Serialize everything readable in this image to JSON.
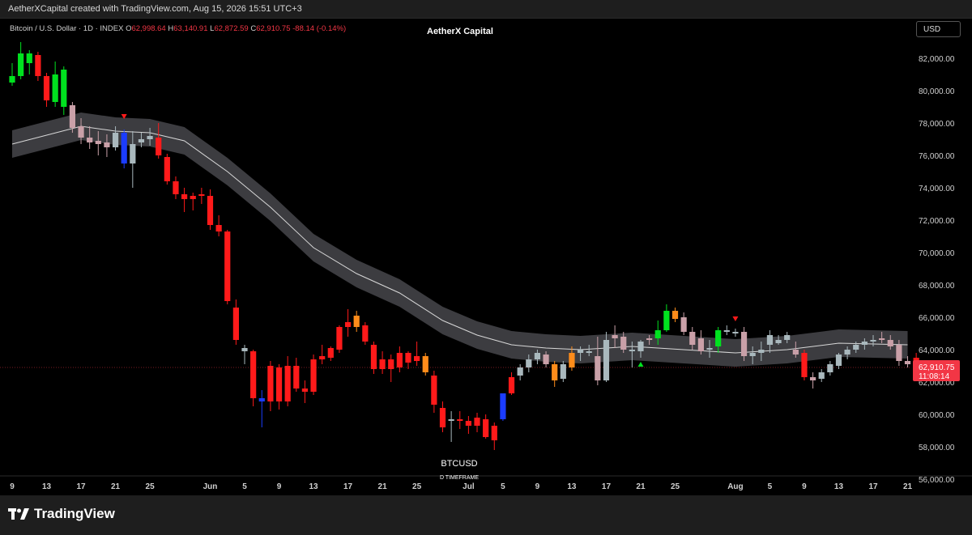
{
  "header": {
    "attribution": "AetherXCapital created with TradingView.com, Aug 15, 2026 15:51 UTC+3"
  },
  "legend": {
    "symbol": "Bitcoin / U.S. Dollar · 1D · INDEX",
    "o_label": "O",
    "o_value": "62,998.64",
    "h_label": "H",
    "h_value": "63,140.91",
    "l_label": "L",
    "l_value": "62,872.59",
    "c_label": "C",
    "c_value": "62,910.75",
    "change": "-88.14 (-0.14%)"
  },
  "chart_title": "AetherX Capital",
  "currency": "USD",
  "brand": "TradingView",
  "chart_data": {
    "type": "candlestick",
    "title": "AetherX Capital",
    "symbol": "BTCUSD",
    "timeframe_label": "D TIMEFRAME",
    "ylim": [
      55000,
      84500
    ],
    "y_ticks": [
      56000,
      58000,
      60000,
      62000,
      64000,
      66000,
      68000,
      70000,
      72000,
      74000,
      76000,
      78000,
      80000,
      82000
    ],
    "y_tick_labels": [
      "56,000.00",
      "58,000.00",
      "60,000.00",
      "62,000.00",
      "64,000.00",
      "66,000.00",
      "68,000.00",
      "70,000.00",
      "72,000.00",
      "74,000.00",
      "76,000.00",
      "78,000.00",
      "80,000.00",
      "82,000.00"
    ],
    "x_ticks": [
      {
        "i": 0,
        "label": "9"
      },
      {
        "i": 4,
        "label": "13"
      },
      {
        "i": 8,
        "label": "17"
      },
      {
        "i": 12,
        "label": "21"
      },
      {
        "i": 16,
        "label": "25"
      },
      {
        "i": 23,
        "label": "Jun"
      },
      {
        "i": 27,
        "label": "5"
      },
      {
        "i": 31,
        "label": "9"
      },
      {
        "i": 35,
        "label": "13"
      },
      {
        "i": 39,
        "label": "17"
      },
      {
        "i": 43,
        "label": "21"
      },
      {
        "i": 47,
        "label": "25"
      },
      {
        "i": 53,
        "label": "Jul"
      },
      {
        "i": 57,
        "label": "5"
      },
      {
        "i": 61,
        "label": "9"
      },
      {
        "i": 65,
        "label": "13"
      },
      {
        "i": 69,
        "label": "17"
      },
      {
        "i": 73,
        "label": "21"
      },
      {
        "i": 77,
        "label": "25"
      },
      {
        "i": 84,
        "label": "Aug"
      },
      {
        "i": 88,
        "label": "5"
      },
      {
        "i": 92,
        "label": "9"
      },
      {
        "i": 96,
        "label": "13"
      },
      {
        "i": 100,
        "label": "17"
      },
      {
        "i": 104,
        "label": "21"
      }
    ],
    "last_price": "62,910.75",
    "countdown": "11:08:14",
    "colors": {
      "bull": "#00e21f",
      "bear": "#ff1a1a",
      "neutral": "#a9b8bd",
      "pink": "#c9a0a8",
      "orange": "#ff8c1a",
      "blue": "#1b3cff",
      "band": "#46464b",
      "ma": "#d8d8d8",
      "price_line": "#f23645"
    },
    "candles": [
      {
        "o": 80500,
        "h": 81700,
        "l": 80300,
        "c": 80900,
        "k": "bull"
      },
      {
        "o": 80900,
        "h": 83000,
        "l": 80700,
        "c": 82300,
        "k": "bull"
      },
      {
        "o": 82300,
        "h": 82500,
        "l": 81000,
        "c": 81700,
        "k": "bull"
      },
      {
        "o": 82200,
        "h": 82400,
        "l": 80600,
        "c": 80900,
        "k": "bear"
      },
      {
        "o": 80900,
        "h": 81100,
        "l": 79000,
        "c": 79400,
        "k": "bear"
      },
      {
        "o": 79300,
        "h": 81800,
        "l": 79000,
        "c": 81000,
        "k": "bull"
      },
      {
        "o": 81300,
        "h": 81500,
        "l": 78500,
        "c": 79000,
        "k": "bull"
      },
      {
        "o": 79100,
        "h": 79300,
        "l": 77400,
        "c": 77700,
        "k": "pink"
      },
      {
        "o": 77800,
        "h": 78300,
        "l": 76700,
        "c": 77100,
        "k": "pink"
      },
      {
        "o": 77100,
        "h": 77800,
        "l": 76400,
        "c": 76800,
        "k": "pink"
      },
      {
        "o": 76900,
        "h": 77500,
        "l": 76000,
        "c": 76700,
        "k": "pink"
      },
      {
        "o": 76800,
        "h": 77300,
        "l": 75900,
        "c": 76500,
        "k": "pink"
      },
      {
        "o": 76500,
        "h": 77800,
        "l": 76300,
        "c": 77400,
        "k": "neutral"
      },
      {
        "o": 77400,
        "h": 77600,
        "l": 75200,
        "c": 75500,
        "k": "blue"
      },
      {
        "o": 75500,
        "h": 77500,
        "l": 74000,
        "c": 76700,
        "k": "neutral"
      },
      {
        "o": 76800,
        "h": 77400,
        "l": 76500,
        "c": 77000,
        "k": "neutral"
      },
      {
        "o": 77000,
        "h": 77700,
        "l": 76600,
        "c": 77200,
        "k": "neutral"
      },
      {
        "o": 77100,
        "h": 78000,
        "l": 75800,
        "c": 76000,
        "k": "bear"
      },
      {
        "o": 75900,
        "h": 76100,
        "l": 74200,
        "c": 74400,
        "k": "bear"
      },
      {
        "o": 74400,
        "h": 74700,
        "l": 73300,
        "c": 73600,
        "k": "bear"
      },
      {
        "o": 73600,
        "h": 74000,
        "l": 72500,
        "c": 73300,
        "k": "bear"
      },
      {
        "o": 73300,
        "h": 73700,
        "l": 72600,
        "c": 73500,
        "k": "bear"
      },
      {
        "o": 73500,
        "h": 74000,
        "l": 73000,
        "c": 73600,
        "k": "bear"
      },
      {
        "o": 73500,
        "h": 73900,
        "l": 71400,
        "c": 71700,
        "k": "bear"
      },
      {
        "o": 71700,
        "h": 72300,
        "l": 71000,
        "c": 71300,
        "k": "bear"
      },
      {
        "o": 71300,
        "h": 71400,
        "l": 66800,
        "c": 67000,
        "k": "bear"
      },
      {
        "o": 66600,
        "h": 67100,
        "l": 64300,
        "c": 64600,
        "k": "bear"
      },
      {
        "o": 64100,
        "h": 64300,
        "l": 63100,
        "c": 63900,
        "k": "neutral"
      },
      {
        "o": 63900,
        "h": 64000,
        "l": 60500,
        "c": 61000,
        "k": "bear"
      },
      {
        "o": 61000,
        "h": 61500,
        "l": 59200,
        "c": 60800,
        "k": "blue"
      },
      {
        "o": 60800,
        "h": 63300,
        "l": 60200,
        "c": 63000,
        "k": "bear"
      },
      {
        "o": 62900,
        "h": 63100,
        "l": 60300,
        "c": 60800,
        "k": "bear"
      },
      {
        "o": 60800,
        "h": 63600,
        "l": 60500,
        "c": 63000,
        "k": "bear"
      },
      {
        "o": 63000,
        "h": 63500,
        "l": 61400,
        "c": 61600,
        "k": "bear"
      },
      {
        "o": 61600,
        "h": 62100,
        "l": 60700,
        "c": 61400,
        "k": "bear"
      },
      {
        "o": 61400,
        "h": 63700,
        "l": 61200,
        "c": 63400,
        "k": "bear"
      },
      {
        "o": 63400,
        "h": 64300,
        "l": 63100,
        "c": 63600,
        "k": "bear"
      },
      {
        "o": 63500,
        "h": 64200,
        "l": 63300,
        "c": 64100,
        "k": "bear"
      },
      {
        "o": 64000,
        "h": 65500,
        "l": 63800,
        "c": 65400,
        "k": "bear"
      },
      {
        "o": 65400,
        "h": 66500,
        "l": 64800,
        "c": 65700,
        "k": "bear"
      },
      {
        "o": 66100,
        "h": 66400,
        "l": 65100,
        "c": 65400,
        "k": "orange"
      },
      {
        "o": 65500,
        "h": 65700,
        "l": 64300,
        "c": 64500,
        "k": "bear"
      },
      {
        "o": 64300,
        "h": 64500,
        "l": 62500,
        "c": 62800,
        "k": "bear"
      },
      {
        "o": 62800,
        "h": 63900,
        "l": 62500,
        "c": 63400,
        "k": "bear"
      },
      {
        "o": 63400,
        "h": 63700,
        "l": 62000,
        "c": 62800,
        "k": "bear"
      },
      {
        "o": 62900,
        "h": 64200,
        "l": 62600,
        "c": 63800,
        "k": "bear"
      },
      {
        "o": 63800,
        "h": 63900,
        "l": 62800,
        "c": 63200,
        "k": "bear"
      },
      {
        "o": 63300,
        "h": 64500,
        "l": 63000,
        "c": 63600,
        "k": "bear"
      },
      {
        "o": 63600,
        "h": 63800,
        "l": 62400,
        "c": 62600,
        "k": "orange"
      },
      {
        "o": 62400,
        "h": 62700,
        "l": 60100,
        "c": 60600,
        "k": "bear"
      },
      {
        "o": 60400,
        "h": 60800,
        "l": 58900,
        "c": 59200,
        "k": "bear"
      },
      {
        "o": 59600,
        "h": 60200,
        "l": 58300,
        "c": 59700,
        "k": "neutral"
      },
      {
        "o": 59700,
        "h": 60200,
        "l": 59100,
        "c": 59600,
        "k": "bear"
      },
      {
        "o": 59600,
        "h": 59900,
        "l": 58800,
        "c": 59300,
        "k": "bear"
      },
      {
        "o": 59300,
        "h": 60100,
        "l": 58900,
        "c": 59800,
        "k": "bear"
      },
      {
        "o": 59700,
        "h": 60000,
        "l": 58500,
        "c": 58600,
        "k": "bear"
      },
      {
        "o": 59300,
        "h": 59500,
        "l": 57800,
        "c": 58400,
        "k": "bear"
      },
      {
        "o": 59700,
        "h": 61300,
        "l": 59600,
        "c": 61300,
        "k": "blue"
      },
      {
        "o": 61300,
        "h": 62600,
        "l": 61200,
        "c": 62300,
        "k": "bear"
      },
      {
        "o": 62400,
        "h": 63100,
        "l": 62100,
        "c": 62900,
        "k": "neutral"
      },
      {
        "o": 62900,
        "h": 63700,
        "l": 62600,
        "c": 63400,
        "k": "neutral"
      },
      {
        "o": 63400,
        "h": 64000,
        "l": 63100,
        "c": 63800,
        "k": "neutral"
      },
      {
        "o": 63700,
        "h": 63900,
        "l": 62900,
        "c": 63100,
        "k": "pink"
      },
      {
        "o": 63100,
        "h": 63300,
        "l": 61700,
        "c": 62100,
        "k": "orange"
      },
      {
        "o": 62200,
        "h": 63300,
        "l": 62000,
        "c": 63100,
        "k": "neutral"
      },
      {
        "o": 62900,
        "h": 64200,
        "l": 62700,
        "c": 63800,
        "k": "orange"
      },
      {
        "o": 63800,
        "h": 64200,
        "l": 63300,
        "c": 64000,
        "k": "neutral"
      },
      {
        "o": 63900,
        "h": 64300,
        "l": 63600,
        "c": 63800,
        "k": "neutral"
      },
      {
        "o": 63600,
        "h": 64800,
        "l": 61800,
        "c": 62100,
        "k": "pink"
      },
      {
        "o": 62100,
        "h": 65100,
        "l": 62000,
        "c": 64600,
        "k": "neutral"
      },
      {
        "o": 64700,
        "h": 65500,
        "l": 64100,
        "c": 64900,
        "k": "pink"
      },
      {
        "o": 64800,
        "h": 65100,
        "l": 63800,
        "c": 64000,
        "k": "pink"
      },
      {
        "o": 64000,
        "h": 64500,
        "l": 62900,
        "c": 63900,
        "k": "neutral"
      },
      {
        "o": 63900,
        "h": 64600,
        "l": 63500,
        "c": 64500,
        "k": "neutral"
      },
      {
        "o": 64600,
        "h": 64900,
        "l": 64300,
        "c": 64700,
        "k": "pink"
      },
      {
        "o": 64700,
        "h": 65800,
        "l": 64300,
        "c": 65200,
        "k": "bull"
      },
      {
        "o": 65200,
        "h": 66800,
        "l": 65100,
        "c": 66400,
        "k": "bull"
      },
      {
        "o": 66400,
        "h": 66600,
        "l": 65700,
        "c": 65900,
        "k": "orange"
      },
      {
        "o": 66000,
        "h": 66300,
        "l": 64900,
        "c": 65100,
        "k": "pink"
      },
      {
        "o": 65100,
        "h": 65400,
        "l": 64000,
        "c": 64300,
        "k": "pink"
      },
      {
        "o": 64700,
        "h": 65200,
        "l": 63700,
        "c": 63900,
        "k": "pink"
      },
      {
        "o": 64000,
        "h": 64600,
        "l": 63500,
        "c": 64100,
        "k": "neutral"
      },
      {
        "o": 64200,
        "h": 65400,
        "l": 63800,
        "c": 65200,
        "k": "bull"
      },
      {
        "o": 65200,
        "h": 65500,
        "l": 64900,
        "c": 65100,
        "k": "neutral"
      },
      {
        "o": 65000,
        "h": 65300,
        "l": 64800,
        "c": 65100,
        "k": "neutral"
      },
      {
        "o": 65100,
        "h": 65400,
        "l": 63300,
        "c": 63600,
        "k": "pink"
      },
      {
        "o": 63600,
        "h": 64200,
        "l": 63100,
        "c": 63800,
        "k": "neutral"
      },
      {
        "o": 63800,
        "h": 64500,
        "l": 63300,
        "c": 64000,
        "k": "neutral"
      },
      {
        "o": 64300,
        "h": 65200,
        "l": 63800,
        "c": 64900,
        "k": "neutral"
      },
      {
        "o": 64600,
        "h": 64900,
        "l": 64300,
        "c": 64400,
        "k": "neutral"
      },
      {
        "o": 64900,
        "h": 65100,
        "l": 64400,
        "c": 64600,
        "k": "neutral"
      },
      {
        "o": 64000,
        "h": 64500,
        "l": 63500,
        "c": 63700,
        "k": "pink"
      },
      {
        "o": 63800,
        "h": 64000,
        "l": 62100,
        "c": 62300,
        "k": "bear"
      },
      {
        "o": 62300,
        "h": 62600,
        "l": 61600,
        "c": 62100,
        "k": "pink"
      },
      {
        "o": 62200,
        "h": 62800,
        "l": 62000,
        "c": 62600,
        "k": "neutral"
      },
      {
        "o": 62600,
        "h": 63300,
        "l": 62400,
        "c": 63100,
        "k": "neutral"
      },
      {
        "o": 63000,
        "h": 63800,
        "l": 62800,
        "c": 63700,
        "k": "neutral"
      },
      {
        "o": 63700,
        "h": 64200,
        "l": 63400,
        "c": 64000,
        "k": "neutral"
      },
      {
        "o": 64000,
        "h": 64500,
        "l": 63800,
        "c": 64300,
        "k": "neutral"
      },
      {
        "o": 64300,
        "h": 64700,
        "l": 64000,
        "c": 64500,
        "k": "neutral"
      },
      {
        "o": 64500,
        "h": 64900,
        "l": 64200,
        "c": 64600,
        "k": "neutral"
      },
      {
        "o": 64700,
        "h": 65100,
        "l": 64400,
        "c": 64600,
        "k": "pink"
      },
      {
        "o": 64600,
        "h": 64900,
        "l": 64000,
        "c": 64200,
        "k": "pink"
      },
      {
        "o": 64300,
        "h": 64600,
        "l": 63000,
        "c": 63300,
        "k": "pink"
      },
      {
        "o": 63300,
        "h": 63600,
        "l": 62900,
        "c": 63100,
        "k": "pink"
      },
      {
        "o": 63500,
        "h": 63800,
        "l": 62300,
        "c": 62900,
        "k": "bear"
      }
    ],
    "ma": [
      [
        0,
        76700
      ],
      [
        8,
        77800
      ],
      [
        12,
        77500
      ],
      [
        16,
        77400
      ],
      [
        20,
        76900
      ],
      [
        25,
        75000
      ],
      [
        30,
        72800
      ],
      [
        35,
        70300
      ],
      [
        40,
        68700
      ],
      [
        45,
        67500
      ],
      [
        50,
        65800
      ],
      [
        54,
        64900
      ],
      [
        58,
        64300
      ],
      [
        62,
        64100
      ],
      [
        66,
        64000
      ],
      [
        72,
        64200
      ],
      [
        78,
        64000
      ],
      [
        84,
        63800
      ],
      [
        90,
        64000
      ],
      [
        96,
        64400
      ],
      [
        104,
        64300
      ]
    ],
    "band_width": 1700
  }
}
